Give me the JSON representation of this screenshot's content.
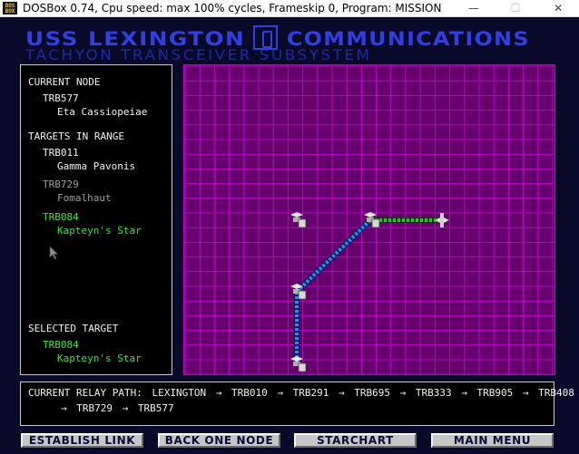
{
  "window": {
    "icon_text": "DOS BOX",
    "title": "DOSBox 0.74, Cpu speed: max 100% cycles, Frameskip  0, Program:  MISSION",
    "minimize": "—",
    "maximize": "☐",
    "close": "✕"
  },
  "header": {
    "title_left": "USS LEXINGTON",
    "title_right": "COMMUNICATIONS",
    "subtitle": "TACHYON TRANSCEIVER SUBSYSTEM"
  },
  "left_panel": {
    "current_node_label": "CURRENT NODE",
    "current_node": {
      "id": "TRB577",
      "name": "Eta Cassiopeiae"
    },
    "targets_label": "TARGETS IN RANGE",
    "targets": [
      {
        "id": "TRB011",
        "name": "Gamma Pavonis",
        "state": "available"
      },
      {
        "id": "TRB729",
        "name": "Fomalhaut",
        "state": "dimmed"
      },
      {
        "id": "TRB084",
        "name": "Kapteyn's Star",
        "state": "selected"
      }
    ],
    "selected_label": "SELECTED TARGET",
    "selected_target": {
      "id": "TRB084",
      "name": "Kapteyn's Star"
    }
  },
  "relay": {
    "label": "CURRENT RELAY PATH:",
    "arrow": "→",
    "path": [
      "LEXINGTON",
      "TRB010",
      "TRB291",
      "TRB695",
      "TRB333",
      "TRB905",
      "TRB408",
      "TRB729",
      "TRB577"
    ]
  },
  "buttons": {
    "establish_link": "ESTABLISH LINK",
    "back_one_node": "BACK ONE NODE",
    "starchart": "STARCHART",
    "main_menu": "MAIN MENU"
  },
  "colors": {
    "header_blue": "#2f3fe0",
    "grid_bg": "#65006d",
    "grid_line": "#c000c8",
    "highlight_green": "#40e040",
    "link_blue": "#2a8cff",
    "link_green": "#30c030"
  }
}
